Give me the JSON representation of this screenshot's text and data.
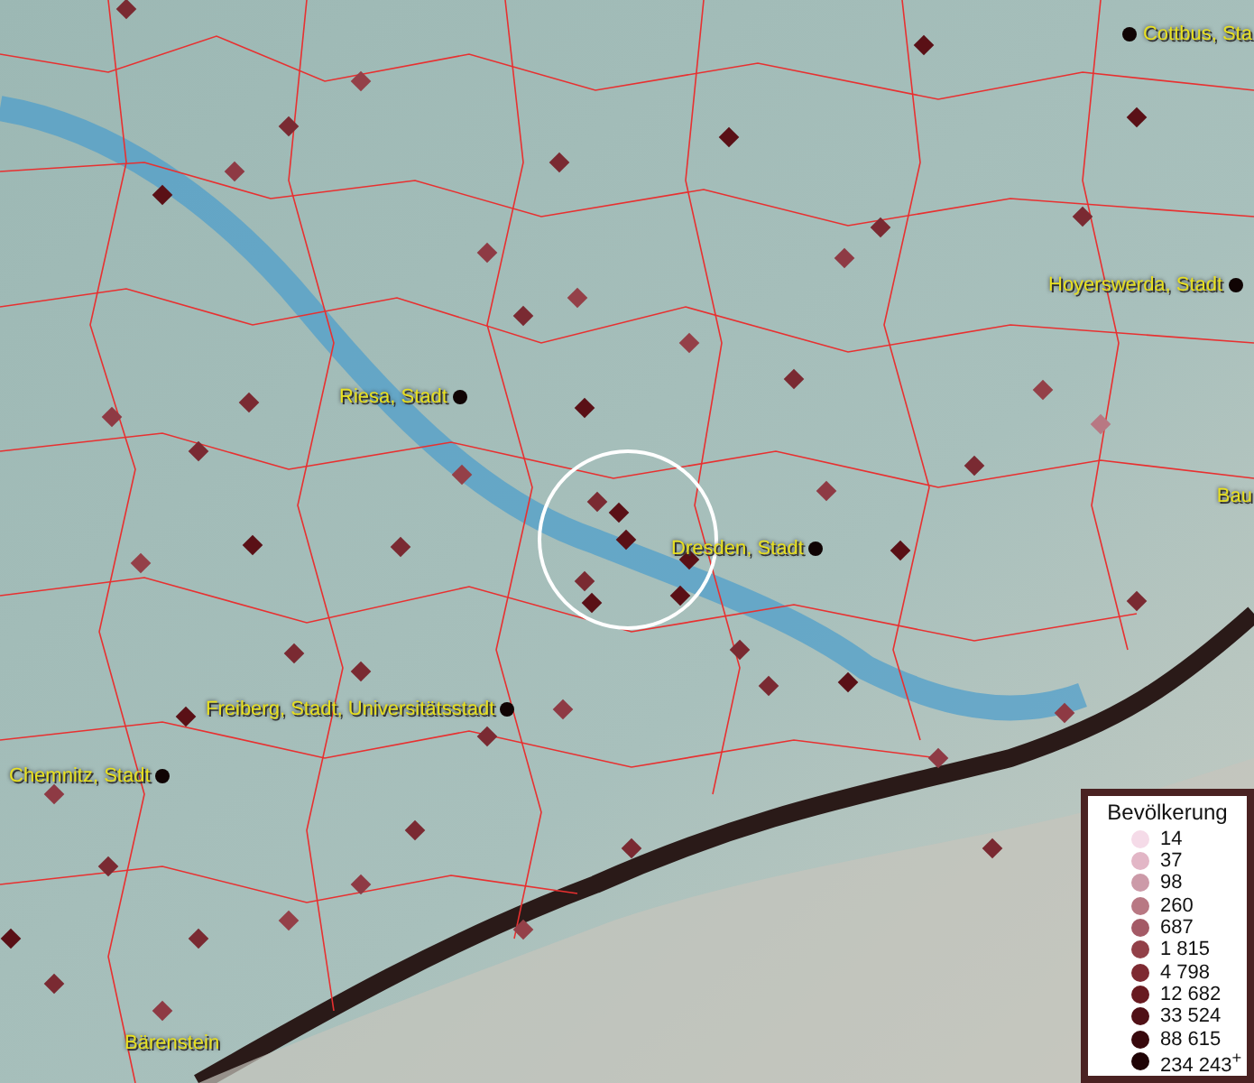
{
  "map": {
    "places": [
      {
        "label": "Cottbus, Sta"
      },
      {
        "label": "Hoyerswerda, Stadt"
      },
      {
        "label": "Riesa, Stadt"
      },
      {
        "label": "Bau"
      },
      {
        "label": "Dresden, Stadt"
      },
      {
        "label": "Freiberg, Stadt, Universitätsstadt"
      },
      {
        "label": "Chemnitz, Stadt"
      },
      {
        "label": "Bärenstein"
      }
    ]
  },
  "legend": {
    "title": "Bevölkerung",
    "items": [
      {
        "label": "14",
        "color": "#f5dbe8"
      },
      {
        "label": "37",
        "color": "#e2b6c6"
      },
      {
        "label": "98",
        "color": "#cc9aa8"
      },
      {
        "label": "260",
        "color": "#b87883"
      },
      {
        "label": "687",
        "color": "#a45a66"
      },
      {
        "label": "1 815",
        "color": "#924048"
      },
      {
        "label": "4 798",
        "color": "#7e2a32"
      },
      {
        "label": "12 682",
        "color": "#681a20"
      },
      {
        "label": "33 524",
        "color": "#501016"
      },
      {
        "label": "88 615",
        "color": "#38080c"
      },
      {
        "label": "234 243$^{+}$",
        "color": "#200406"
      }
    ]
  }
}
